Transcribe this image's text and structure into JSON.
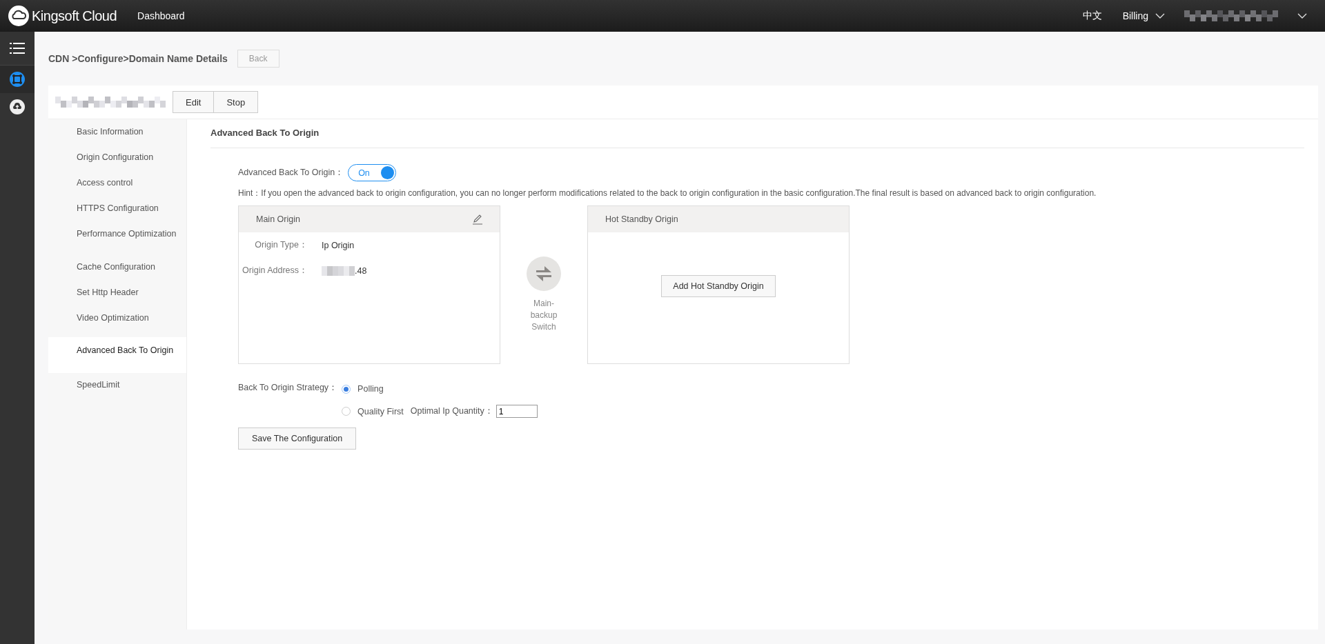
{
  "top_bar": {
    "logo_text": "Kingsoft Cloud",
    "nav_link": "Dashboard",
    "language": "中文",
    "billing_menu": "Billing"
  },
  "breadcrumb": "CDN >Configure>Domain Name Details",
  "back_button": "Back",
  "domain_actions": [
    "Edit",
    "Stop"
  ],
  "nav": [
    {
      "label": "Basic Information",
      "selected": false
    },
    {
      "label": "Origin Configuration",
      "selected": false
    },
    {
      "label": "Access control",
      "selected": false
    },
    {
      "label": "HTTPS Configuration",
      "selected": false
    },
    {
      "label": "Performance Optimization",
      "selected": false
    },
    {
      "label": "Cache Configuration",
      "selected": false
    },
    {
      "label": "Set Http Header",
      "selected": false
    },
    {
      "label": "Video Optimization",
      "selected": false
    },
    {
      "label": "Advanced Back To Origin",
      "selected": true
    },
    {
      "label": "SpeedLimit",
      "selected": false
    }
  ],
  "section_title": "Advanced Back To Origin",
  "toggle": {
    "label": "Advanced Back To Origin：",
    "on": true,
    "text": "On"
  },
  "hint": "Hint：If you open the advanced back to origin configuration, you can no longer perform modifications related to the back to origin configuration in the basic configuration.The final result is based on advanced back to origin configuration.",
  "main_origin": {
    "title": "Main Origin",
    "fields": [
      {
        "label": "Origin Type：",
        "value": "Ip Origin",
        "redacted": false
      },
      {
        "label": "Origin Address：",
        "value": ".48",
        "redacted": true
      }
    ]
  },
  "switch_label": "Main-backup Switch",
  "standby": {
    "title": "Hot Standby Origin",
    "button": "Add Hot Standby Origin"
  },
  "strategy": {
    "label": "Back To Origin Strategy：",
    "options": [
      {
        "label": "Polling",
        "selected": true
      },
      {
        "label": "Quality First",
        "selected": false,
        "extra_label": "Optimal Ip Quantity：",
        "extra_value": "1"
      }
    ]
  },
  "save_button": "Save The Configuration"
}
